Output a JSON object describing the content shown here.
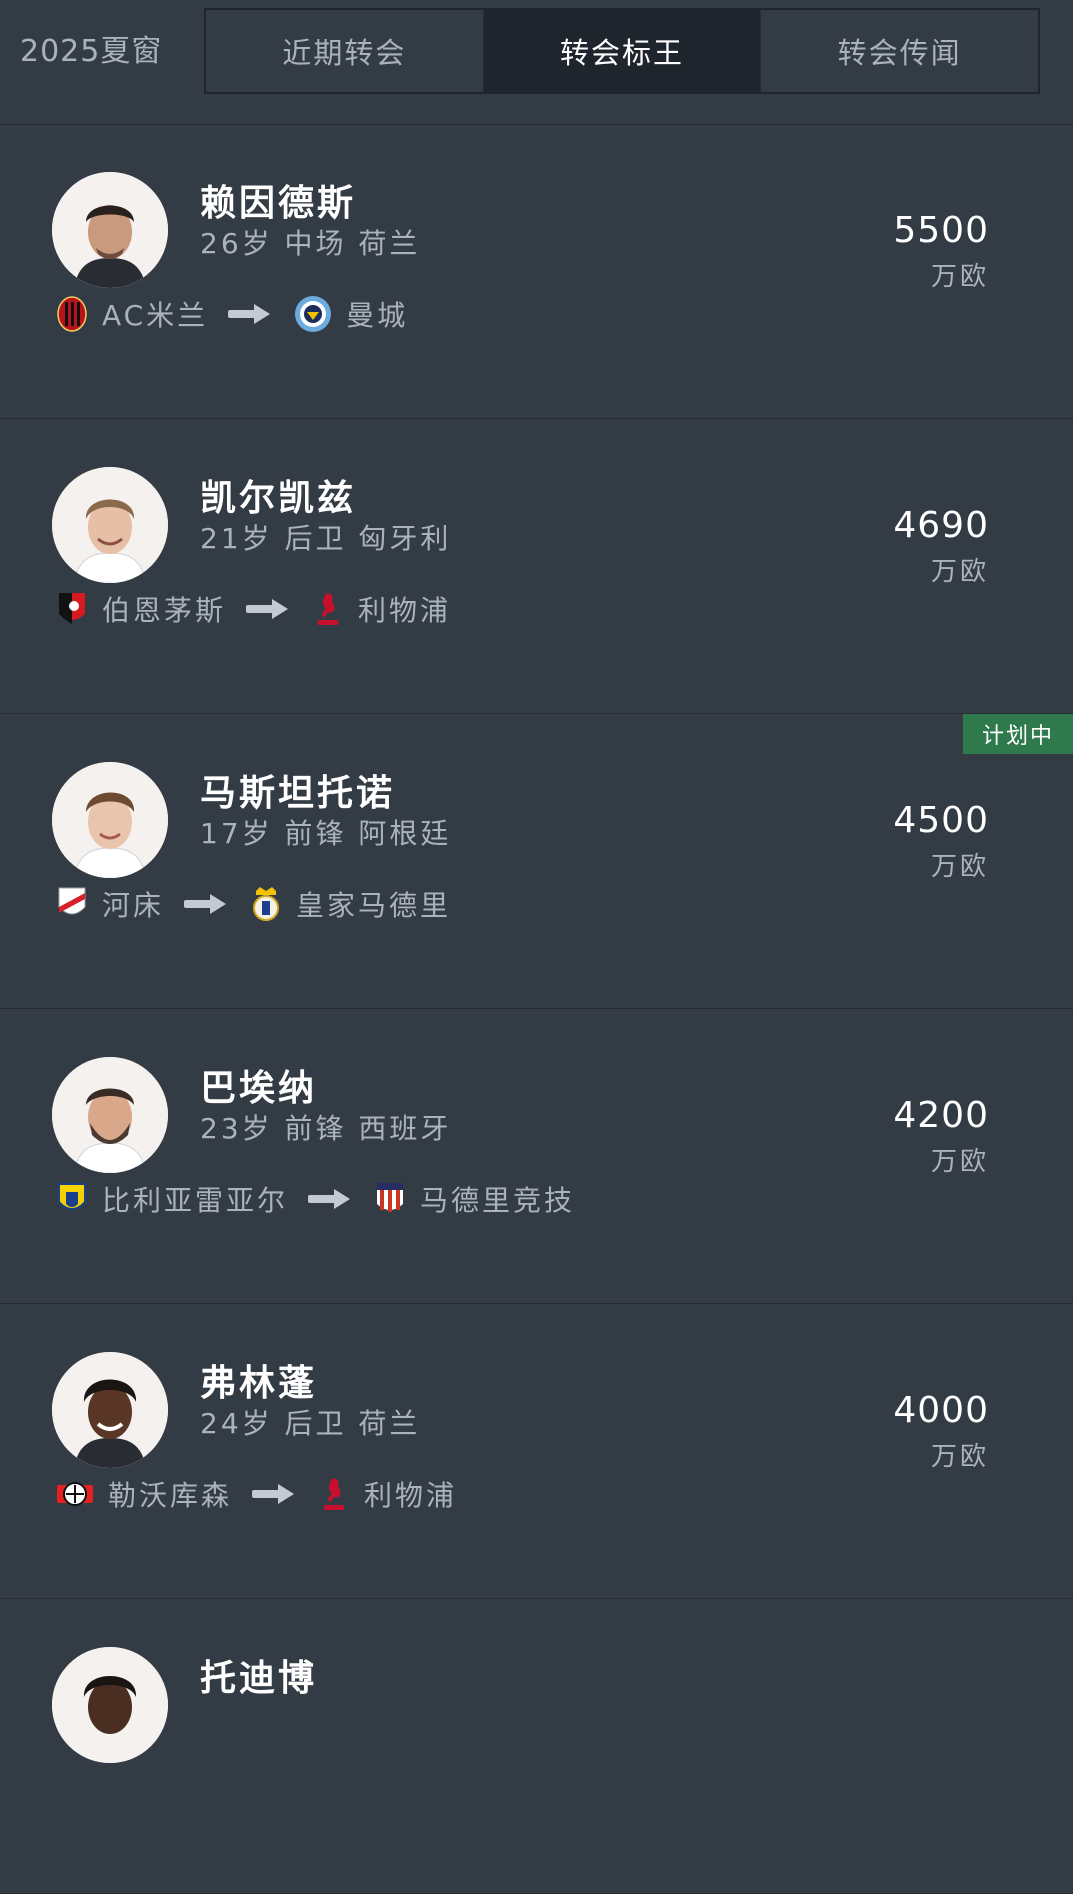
{
  "header": {
    "season": "2025夏窗",
    "tabs": [
      {
        "label": "近期转会",
        "active": false
      },
      {
        "label": "转会标王",
        "active": true
      },
      {
        "label": "转会传闻",
        "active": false
      }
    ]
  },
  "colors": {
    "background": "#333b44",
    "active_tab": "#1f252c",
    "status_tag": "#2f7a4d"
  },
  "transfers": [
    {
      "name": "赖因德斯",
      "meta": "26岁 中场 荷兰",
      "from": "AC米兰",
      "from_icon": "ac-milan-crest",
      "to": "曼城",
      "to_icon": "man-city-crest",
      "fee": "5500",
      "unit": "万欧"
    },
    {
      "name": "凯尔凯兹",
      "meta": "21岁 后卫 匈牙利",
      "from": "伯恩茅斯",
      "from_icon": "bournemouth-crest",
      "to": "利物浦",
      "to_icon": "liverpool-crest",
      "fee": "4690",
      "unit": "万欧"
    },
    {
      "name": "马斯坦托诺",
      "meta": "17岁 前锋 阿根廷",
      "from": "河床",
      "from_icon": "river-plate-crest",
      "to": "皇家马德里",
      "to_icon": "real-madrid-crest",
      "fee": "4500",
      "unit": "万欧",
      "status": "计划中"
    },
    {
      "name": "巴埃纳",
      "meta": "23岁 前锋 西班牙",
      "from": "比利亚雷亚尔",
      "from_icon": "villarreal-crest",
      "to": "马德里竞技",
      "to_icon": "atletico-crest",
      "fee": "4200",
      "unit": "万欧"
    },
    {
      "name": "弗林蓬",
      "meta": "24岁 后卫 荷兰",
      "from": "勒沃库森",
      "from_icon": "leverkusen-crest",
      "to": "利物浦",
      "to_icon": "liverpool-crest",
      "fee": "4000",
      "unit": "万欧"
    },
    {
      "name": "托迪博"
    }
  ]
}
